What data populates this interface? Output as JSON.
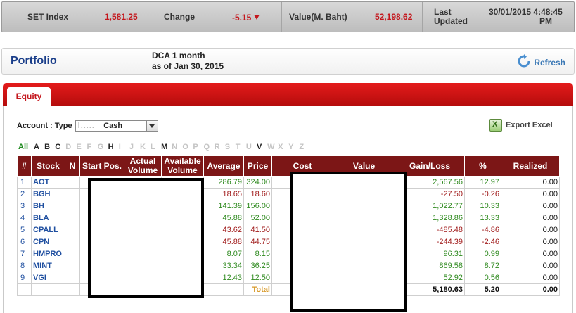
{
  "market": {
    "set_label": "SET Index",
    "set_value": "1,581.25",
    "change_label": "Change",
    "change_value": "-5.15",
    "value_label": "Value(M. Baht)",
    "value_value": "52,198.62",
    "updated_label_1": "Last",
    "updated_label_2": "Updated",
    "updated_date": "30/01/2015 4:48:45",
    "updated_ampm": "PM"
  },
  "portfolio": {
    "title": "Portfolio",
    "plan": "DCA 1 month",
    "as_of": "as of Jan 30, 2015",
    "refresh_label": "Refresh"
  },
  "tabs": {
    "equity": "Equity"
  },
  "account": {
    "label": "Account : Type",
    "masked": "l.....",
    "selected": "Cash"
  },
  "export_label": "Export Excel",
  "alphabet": {
    "all": "All",
    "letters": [
      "A",
      "B",
      "C",
      "D",
      "E",
      "F",
      "G",
      "H",
      "I",
      "J",
      "K",
      "L",
      "M",
      "N",
      "O",
      "P",
      "Q",
      "R",
      "S",
      "T",
      "U",
      "V",
      "W",
      "X",
      "Y",
      "Z"
    ],
    "active": [
      "A",
      "B",
      "C",
      "H",
      "M",
      "V"
    ]
  },
  "table": {
    "headers": {
      "num": "#",
      "stock": "Stock",
      "n": "N",
      "start_pos": "Start Pos.",
      "actual_1": "Actual",
      "actual_2": "Volume",
      "available_1": "Available",
      "available_2": "Volume",
      "average": "Average",
      "price": "Price",
      "cost": "Cost",
      "value": "Value",
      "gain_loss": "Gain/Loss",
      "pct": "%",
      "realized": "Realized"
    },
    "rows": [
      {
        "num": "1",
        "stock": "AOT",
        "average": "286.79",
        "price": "324.00",
        "gain": "2,567.56",
        "pct": "12.97",
        "realized": "0.00",
        "trend": "pos"
      },
      {
        "num": "2",
        "stock": "BGH",
        "average": "18.65",
        "price": "18.60",
        "gain": "-27.50",
        "pct": "-0.26",
        "realized": "0.00",
        "trend": "neg"
      },
      {
        "num": "3",
        "stock": "BH",
        "average": "141.39",
        "price": "156.00",
        "gain": "1,022.77",
        "pct": "10.33",
        "realized": "0.00",
        "trend": "pos"
      },
      {
        "num": "4",
        "stock": "BLA",
        "average": "45.88",
        "price": "52.00",
        "gain": "1,328.86",
        "pct": "13.33",
        "realized": "0.00",
        "trend": "pos"
      },
      {
        "num": "5",
        "stock": "CPALL",
        "average": "43.62",
        "price": "41.50",
        "gain": "-485.48",
        "pct": "-4.86",
        "realized": "0.00",
        "trend": "neg"
      },
      {
        "num": "6",
        "stock": "CPN",
        "average": "45.88",
        "price": "44.75",
        "gain": "-244.39",
        "pct": "-2.46",
        "realized": "0.00",
        "trend": "neg"
      },
      {
        "num": "7",
        "stock": "HMPRO",
        "average": "8.07",
        "price": "8.15",
        "gain": "96.31",
        "pct": "0.99",
        "realized": "0.00",
        "trend": "pos"
      },
      {
        "num": "8",
        "stock": "MINT",
        "average": "33.34",
        "price": "36.25",
        "gain": "869.58",
        "pct": "8.72",
        "realized": "0.00",
        "trend": "pos"
      },
      {
        "num": "9",
        "stock": "VGI",
        "average": "12.43",
        "price": "12.50",
        "gain": "52.92",
        "pct": "0.56",
        "realized": "0.00",
        "trend": "pos"
      }
    ],
    "total": {
      "label": "Total",
      "gain": "5,180.63",
      "pct": "5.20",
      "realized": "0.00"
    }
  }
}
